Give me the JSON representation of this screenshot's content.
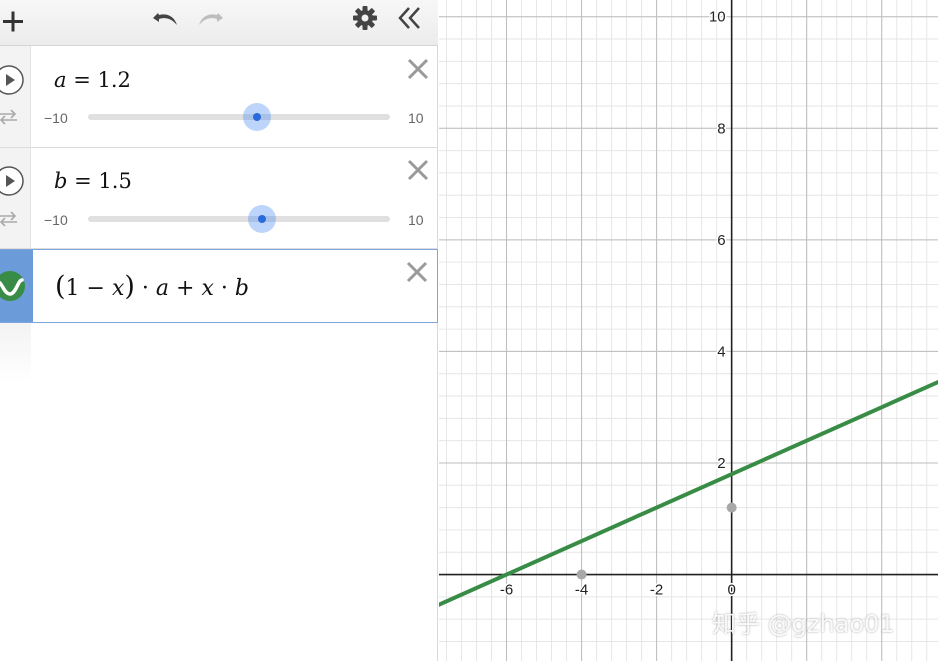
{
  "toolbar": {
    "add_icon": "plus-icon",
    "undo_icon": "undo-icon",
    "redo_icon": "redo-icon",
    "settings_icon": "gear-icon",
    "collapse_icon": "double-chevron-left-icon"
  },
  "expressions": [
    {
      "type": "slider",
      "variable": "a",
      "equals": " = ",
      "value": "1.2",
      "min_label": "−10",
      "max_label": "10",
      "min": -10,
      "max": 10,
      "current": 1.2
    },
    {
      "type": "slider",
      "variable": "b",
      "equals": " = ",
      "value": "1.5",
      "min_label": "−10",
      "max_label": "10",
      "min": -10,
      "max": 10,
      "current": 1.5
    },
    {
      "type": "function",
      "parts": [
        "(",
        "1 − ",
        "x",
        ")",
        " · ",
        "a",
        " + ",
        "x",
        " · ",
        "b"
      ],
      "color": "#388c46"
    }
  ],
  "colors": {
    "accent": "#4285f4",
    "line": "#388c46",
    "selected_gutter": "#6b9bd8"
  },
  "chart_data": {
    "type": "line",
    "x": [
      -8,
      6
    ],
    "y": [
      -0.6,
      3.6
    ],
    "xlim": [
      -7.8,
      5.5
    ],
    "ylim": [
      -1.55,
      10.3
    ],
    "x_ticks": [
      -6,
      -4,
      -2,
      0
    ],
    "y_ticks": [
      2,
      4,
      6,
      8,
      10
    ],
    "x_tick_labels": [
      "-6",
      "-4",
      "-2",
      "0"
    ],
    "y_tick_labels": [
      "2",
      "4",
      "6",
      "8",
      "10"
    ],
    "points": [
      {
        "x": -4,
        "y": 0
      },
      {
        "x": 0,
        "y": 1.2
      }
    ],
    "grid": true
  },
  "watermark": "知乎 @gzhao01"
}
